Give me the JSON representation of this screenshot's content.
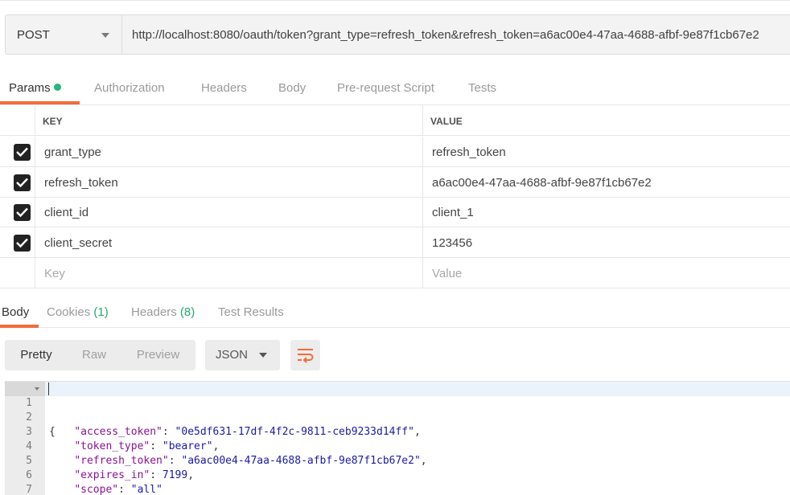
{
  "request": {
    "method": "POST",
    "url": "http://localhost:8080/oauth/token?grant_type=refresh_token&refresh_token=a6ac00e4-47aa-4688-afbf-9e87f1cb67e2"
  },
  "request_tabs": [
    {
      "label": "Params",
      "active": true,
      "has_dot": true
    },
    {
      "label": "Authorization"
    },
    {
      "label": "Headers"
    },
    {
      "label": "Body"
    },
    {
      "label": "Pre-request Script"
    },
    {
      "label": "Tests"
    }
  ],
  "params": {
    "header_key": "KEY",
    "header_value": "VALUE",
    "rows": [
      {
        "checked": true,
        "key": "grant_type",
        "value": "refresh_token"
      },
      {
        "checked": true,
        "key": "refresh_token",
        "value": "a6ac00e4-47aa-4688-afbf-9e87f1cb67e2"
      },
      {
        "checked": true,
        "key": "client_id",
        "value": "client_1"
      },
      {
        "checked": true,
        "key": "client_secret",
        "value": "123456"
      }
    ],
    "placeholder_key": "Key",
    "placeholder_value": "Value"
  },
  "response_tabs": [
    {
      "label": "Body",
      "active": true
    },
    {
      "label": "Cookies",
      "count": "(1)"
    },
    {
      "label": "Headers",
      "count": "(8)"
    },
    {
      "label": "Test Results"
    }
  ],
  "view_modes": [
    "Pretty",
    "Raw",
    "Preview"
  ],
  "format": "JSON",
  "code_lines": [
    {
      "n": "1",
      "text": "{"
    },
    {
      "n": "2",
      "key": "\"access_token\"",
      "val": "\"0e5df631-17df-4f2c-9811-ceb9233d14ff\"",
      "tail": ","
    },
    {
      "n": "3",
      "key": "\"token_type\"",
      "val": "\"bearer\"",
      "tail": ","
    },
    {
      "n": "4",
      "key": "\"refresh_token\"",
      "val": "\"a6ac00e4-47aa-4688-afbf-9e87f1cb67e2\"",
      "tail": ","
    },
    {
      "n": "5",
      "key": "\"expires_in\"",
      "val": "7199",
      "tail": ","
    },
    {
      "n": "6",
      "key": "\"scope\"",
      "val": "\"all\"",
      "tail": ""
    },
    {
      "n": "7",
      "text": "}"
    }
  ],
  "icons": {
    "method_caret": "chevron-down-icon",
    "checkbox": "checkbox-checked-icon",
    "wrap": "word-wrap-icon"
  },
  "colors": {
    "accent": "#f26b3a",
    "dot": "#26b47f",
    "count": "#26a86f",
    "json_key": "#881391",
    "json_value": "#1a1aa6"
  }
}
